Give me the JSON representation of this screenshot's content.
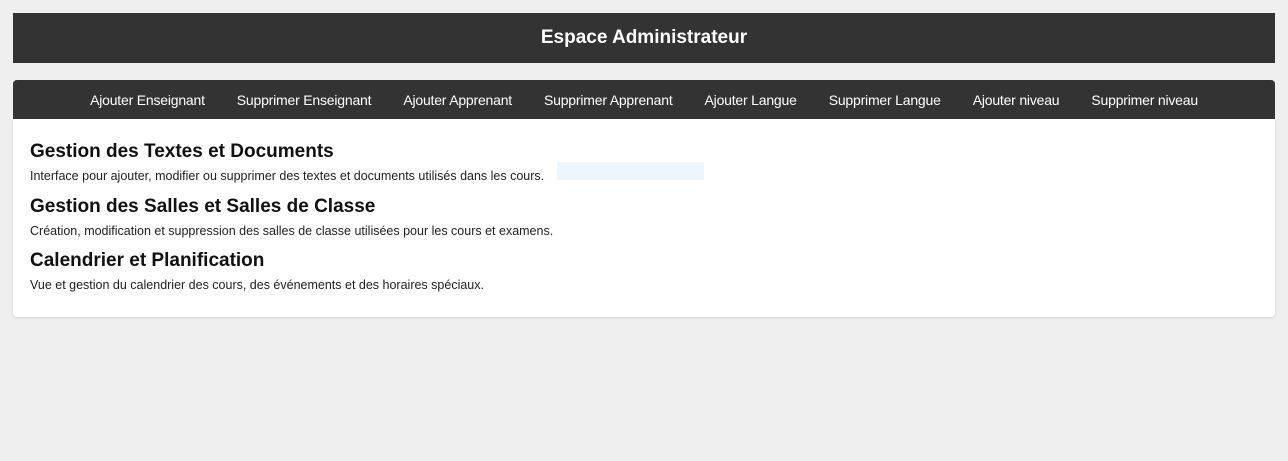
{
  "header": {
    "title": "Espace Administrateur"
  },
  "nav": {
    "items": [
      {
        "label": "Ajouter Enseignant"
      },
      {
        "label": "Supprimer Enseignant"
      },
      {
        "label": "Ajouter Apprenant"
      },
      {
        "label": "Supprimer Apprenant"
      },
      {
        "label": "Ajouter Langue"
      },
      {
        "label": "Supprimer Langue"
      },
      {
        "label": "Ajouter niveau"
      },
      {
        "label": "Supprimer niveau"
      }
    ]
  },
  "sections": [
    {
      "title": "Gestion des Textes et Documents",
      "description": "Interface pour ajouter, modifier ou supprimer des textes et documents utilisés dans les cours."
    },
    {
      "title": "Gestion des Salles et Salles de Classe",
      "description": "Création, modification et suppression des salles de classe utilisées pour les cours et examens."
    },
    {
      "title": "Calendrier et Planification",
      "description": "Vue et gestion du calendrier des cours, des événements et des horaires spéciaux."
    }
  ]
}
